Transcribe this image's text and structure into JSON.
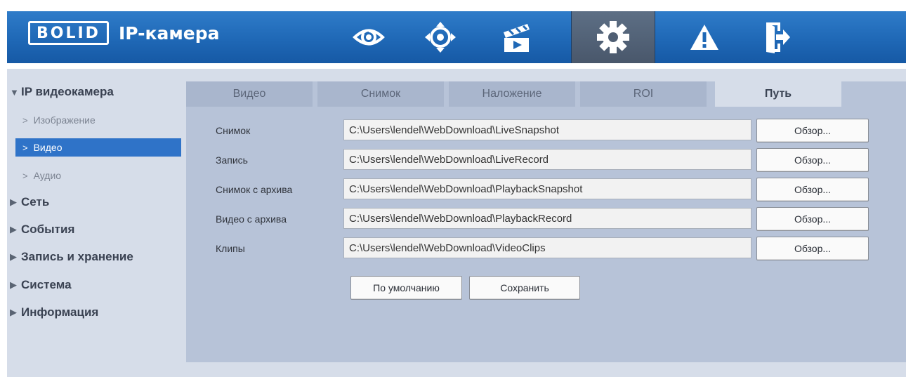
{
  "header": {
    "logo_text": "BOLID",
    "title": "IP-камера",
    "nav_icons": [
      "live-view-eye-icon",
      "ptz-control-icon",
      "playback-clapper-icon",
      "settings-gear-icon",
      "alarm-warning-icon",
      "logout-exit-icon"
    ],
    "active_nav": "settings-gear-icon",
    "colors": {
      "header_bg": "#1f68b6",
      "active_nav_bg": "#4f5e73"
    }
  },
  "sidebar": {
    "sections": [
      {
        "label": "IP видеокамера",
        "expanded": true
      },
      {
        "label": "Сеть",
        "expanded": false
      },
      {
        "label": "События",
        "expanded": false
      },
      {
        "label": "Запись и хранение",
        "expanded": false
      },
      {
        "label": "Система",
        "expanded": false
      },
      {
        "label": "Информация",
        "expanded": false
      }
    ],
    "subitems": [
      {
        "label": "Изображение",
        "active": false
      },
      {
        "label": "Видео",
        "active": true
      },
      {
        "label": "Аудио",
        "active": false
      }
    ]
  },
  "tabs": [
    {
      "label": "Видео",
      "active": false
    },
    {
      "label": "Снимок",
      "active": false
    },
    {
      "label": "Наложение",
      "active": false
    },
    {
      "label": "ROI",
      "active": false
    },
    {
      "label": "Путь",
      "active": true
    }
  ],
  "paths": [
    {
      "label": "Снимок",
      "value": "C:\\Users\\lendel\\WebDownload\\LiveSnapshot",
      "button": "Обзор..."
    },
    {
      "label": "Запись",
      "value": "C:\\Users\\lendel\\WebDownload\\LiveRecord",
      "button": "Обзор..."
    },
    {
      "label": "Снимок с архива",
      "value": "C:\\Users\\lendel\\WebDownload\\PlaybackSnapshot",
      "button": "Обзор..."
    },
    {
      "label": "Видео с архива",
      "value": "C:\\Users\\lendel\\WebDownload\\PlaybackRecord",
      "button": "Обзор..."
    },
    {
      "label": "Клипы",
      "value": "C:\\Users\\lendel\\WebDownload\\VideoClips",
      "button": "Обзор..."
    }
  ],
  "actions": {
    "default_label": "По умолчанию",
    "save_label": "Сохранить"
  },
  "colors": {
    "accent": "#2f73c8",
    "panel_bg": "#b7c3d8",
    "page_bg": "#d6dde9"
  }
}
